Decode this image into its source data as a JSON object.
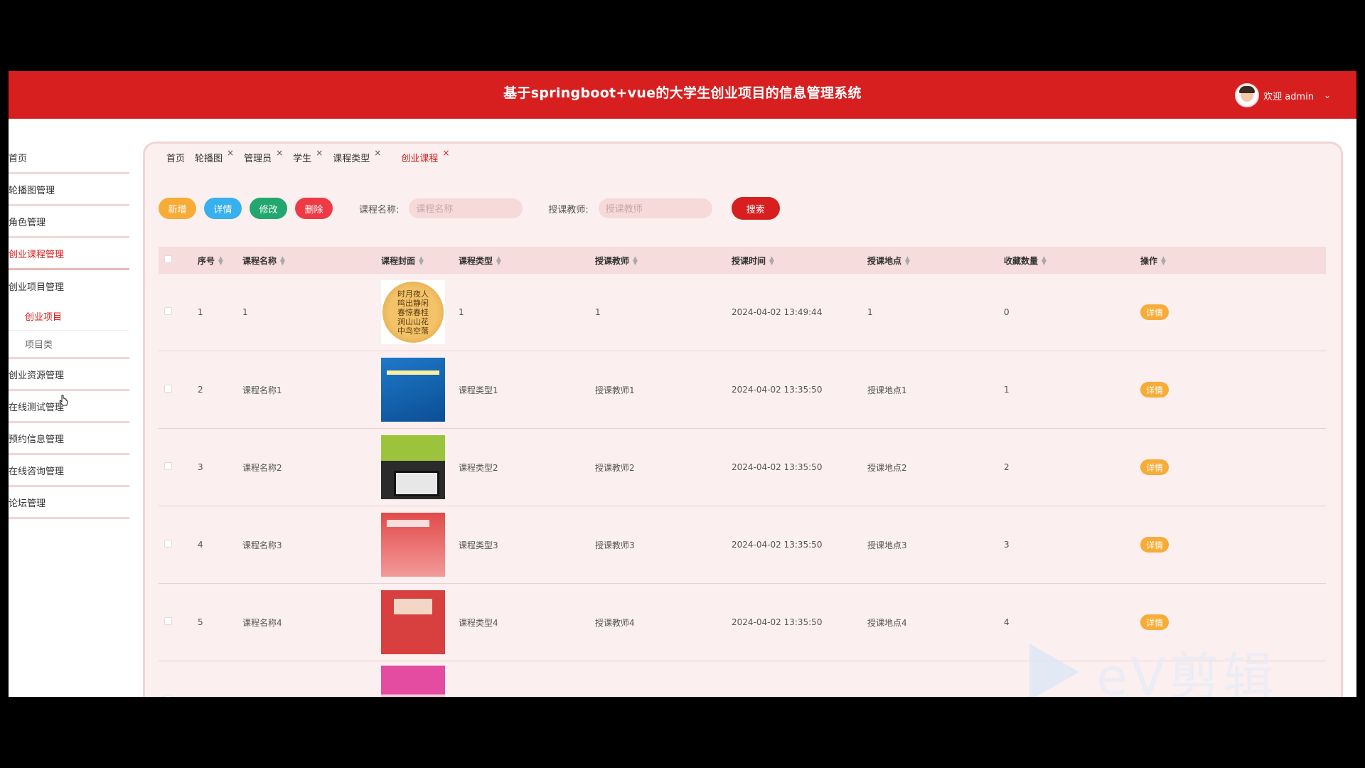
{
  "header": {
    "title": "基于springboot+vue的大学生创业项目的信息管理系统",
    "welcome": "欢迎 admin"
  },
  "sidebar": {
    "items": [
      {
        "label": "首页"
      },
      {
        "label": "轮播图管理"
      },
      {
        "label": "角色管理"
      },
      {
        "label": "创业课程管理",
        "active": true
      },
      {
        "label": "创业项目管理"
      },
      {
        "label": "创业资源管理"
      },
      {
        "label": "在线测试管理"
      },
      {
        "label": "预约信息管理"
      },
      {
        "label": "在线咨询管理"
      },
      {
        "label": "论坛管理"
      }
    ],
    "subitems": [
      {
        "label": "创业项目",
        "active": true
      },
      {
        "label": "项目类"
      }
    ]
  },
  "tabs": [
    "首页",
    "轮播图",
    "管理员",
    "学生",
    "课程类型",
    "创业课程"
  ],
  "toolbar": {
    "add": "新增",
    "detail": "详情",
    "edit": "修改",
    "delete": "删除",
    "name_label": "课程名称:",
    "name_placeholder": "课程名称",
    "teacher_label": "授课教师:",
    "teacher_placeholder": "授课教师",
    "search": "搜索"
  },
  "table": {
    "headers": [
      "序号",
      "课程名称",
      "课程封面",
      "课程类型",
      "授课教师",
      "授课时间",
      "授课地点",
      "收藏数量",
      "操作"
    ],
    "rows": [
      {
        "no": "1",
        "name": "1",
        "type": "1",
        "teacher": "1",
        "time": "2024-04-02 13:49:44",
        "place": "1",
        "fav": "0",
        "op": "详情",
        "cover_text": "时月夜人\n鸣出静闲\n春惊春桂\n涧山山花\n中鸟空落"
      },
      {
        "no": "2",
        "name": "课程名称1",
        "type": "课程类型1",
        "teacher": "授课教师1",
        "time": "2024-04-02 13:35:50",
        "place": "授课地点1",
        "fav": "1",
        "op": "详情"
      },
      {
        "no": "3",
        "name": "课程名称2",
        "type": "课程类型2",
        "teacher": "授课教师2",
        "time": "2024-04-02 13:35:50",
        "place": "授课地点2",
        "fav": "2",
        "op": "详情"
      },
      {
        "no": "4",
        "name": "课程名称3",
        "type": "课程类型3",
        "teacher": "授课教师3",
        "time": "2024-04-02 13:35:50",
        "place": "授课地点3",
        "fav": "3",
        "op": "详情"
      },
      {
        "no": "5",
        "name": "课程名称4",
        "type": "课程类型4",
        "teacher": "授课教师4",
        "time": "2024-04-02 13:35:50",
        "place": "授课地点4",
        "fav": "4",
        "op": "详情"
      }
    ]
  },
  "watermark": "eV剪辑",
  "colors": {
    "primary": "#d71f20",
    "add": "#f7ac38",
    "detail": "#38b0ee",
    "edit": "#22a76f",
    "delete": "#ee3a45"
  }
}
